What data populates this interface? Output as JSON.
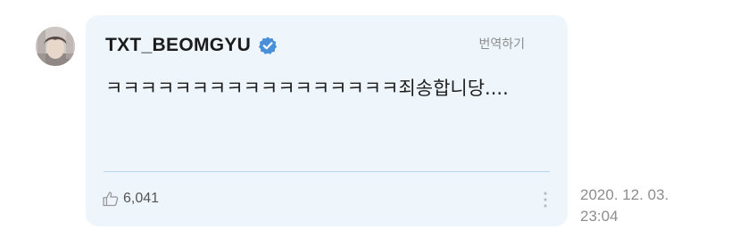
{
  "post": {
    "username": "TXT_BEOMGYU",
    "verified": true,
    "translate_label": "번역하기",
    "message": "ㅋㅋㅋㅋㅋㅋㅋㅋㅋㅋㅋㅋㅋㅋㅋㅋㅋ죄송합니당....",
    "like_count": "6,041",
    "date": "2020. 12. 03.",
    "time": "23:04"
  },
  "icons": {
    "avatar": "avatar-image",
    "verified": "verified-badge-icon",
    "like": "thumbs-up-icon",
    "more": "more-vertical-icon"
  },
  "colors": {
    "card_background": "#eef6fc",
    "verified_blue": "#4a90d9",
    "divider": "#b7d7ee"
  }
}
